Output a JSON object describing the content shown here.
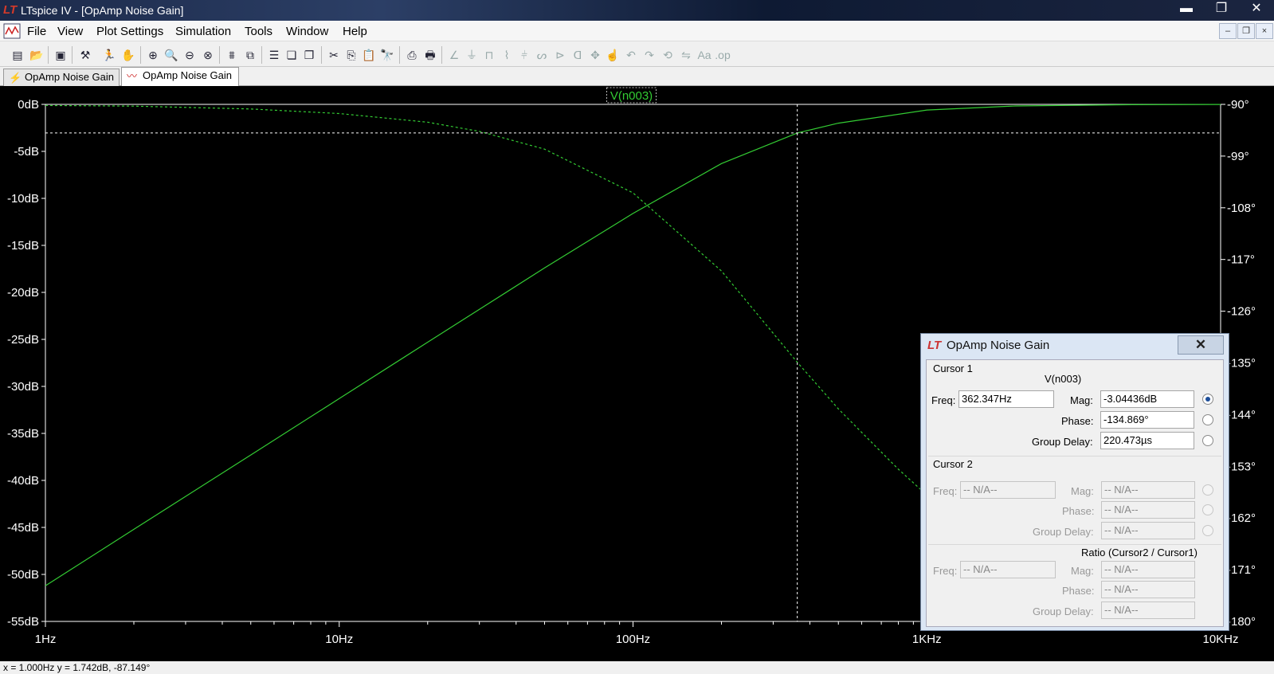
{
  "window": {
    "title": "LTspice IV - [OpAmp Noise Gain]",
    "minimize_glyph": "▬",
    "maximize_glyph": "❐",
    "close_glyph": "✕"
  },
  "menu": {
    "items": [
      "File",
      "View",
      "Plot Settings",
      "Simulation",
      "Tools",
      "Window",
      "Help"
    ]
  },
  "tabs": [
    {
      "label": "OpAmp Noise Gain",
      "icon": "schematic-icon"
    },
    {
      "label": "OpAmp Noise Gain",
      "icon": "waveform-icon"
    }
  ],
  "plot": {
    "trace_label": "V(n003)",
    "trace_color": "#33cc33",
    "status": "x = 1.000Hz    y = 1.742dB, -87.149°"
  },
  "chart_data": {
    "type": "line",
    "xscale": "log",
    "x_ticks": [
      "1Hz",
      "10Hz",
      "100Hz",
      "1KHz",
      "10KHz"
    ],
    "xlim": [
      1,
      10000
    ],
    "y_left_ticks": [
      "0dB",
      "-5dB",
      "-10dB",
      "-15dB",
      "-20dB",
      "-25dB",
      "-30dB",
      "-35dB",
      "-40dB",
      "-45dB",
      "-50dB",
      "-55dB"
    ],
    "ylim_left": [
      -55,
      0
    ],
    "y_right_ticks": [
      "-90°",
      "-99°",
      "-108°",
      "-117°",
      "-126°",
      "-135°",
      "-144°",
      "-153°",
      "-162°",
      "-171°",
      "-180°"
    ],
    "ylim_right": [
      -180,
      -90
    ],
    "series": [
      {
        "name": "V(n003)",
        "style": "solid",
        "axis": "left",
        "x": [
          1,
          2,
          5,
          10,
          20,
          50,
          100,
          200,
          362.347,
          500,
          1000,
          2000,
          5000,
          10000
        ],
        "y": [
          -51.2,
          -45.2,
          -37.3,
          -31.3,
          -25.3,
          -17.4,
          -11.6,
          -6.3,
          -3.04,
          -2.0,
          -0.6,
          -0.17,
          -0.03,
          -0.01
        ]
      },
      {
        "name": "V(n003)",
        "style": "dashed",
        "axis": "right",
        "x": [
          1,
          2,
          5,
          10,
          20,
          30,
          50,
          100,
          200,
          362.347,
          500,
          800,
          1000
        ],
        "y": [
          -90.2,
          -90.3,
          -90.8,
          -91.6,
          -93.1,
          -94.7,
          -97.8,
          -105.4,
          -119.0,
          -134.9,
          -143.0,
          -153.5,
          -158.0
        ]
      }
    ],
    "cursor": {
      "x": 362.347,
      "y": -3.04436
    }
  },
  "cursor_dialog": {
    "title": "OpAmp Noise Gain",
    "cursor1": {
      "heading": "Cursor 1",
      "trace": "V(n003)",
      "freq_label": "Freq:",
      "freq": "362.347Hz",
      "mag_label": "Mag:",
      "mag": "-3.04436dB",
      "phase_label": "Phase:",
      "phase": "-134.869°",
      "gd_label": "Group Delay:",
      "gd": "220.473µs"
    },
    "cursor2": {
      "heading": "Cursor 2",
      "freq_label": "Freq:",
      "freq": "-- N/A--",
      "mag_label": "Mag:",
      "mag": "-- N/A--",
      "phase_label": "Phase:",
      "phase": "-- N/A--",
      "gd_label": "Group Delay:",
      "gd": "-- N/A--"
    },
    "ratio": {
      "heading": "Ratio (Cursor2 / Cursor1)",
      "freq_label": "Freq:",
      "freq": "-- N/A--",
      "mag_label": "Mag:",
      "mag": "-- N/A--",
      "phase_label": "Phase:",
      "phase": "-- N/A--",
      "gd_label": "Group Delay:",
      "gd": "-- N/A--"
    }
  }
}
